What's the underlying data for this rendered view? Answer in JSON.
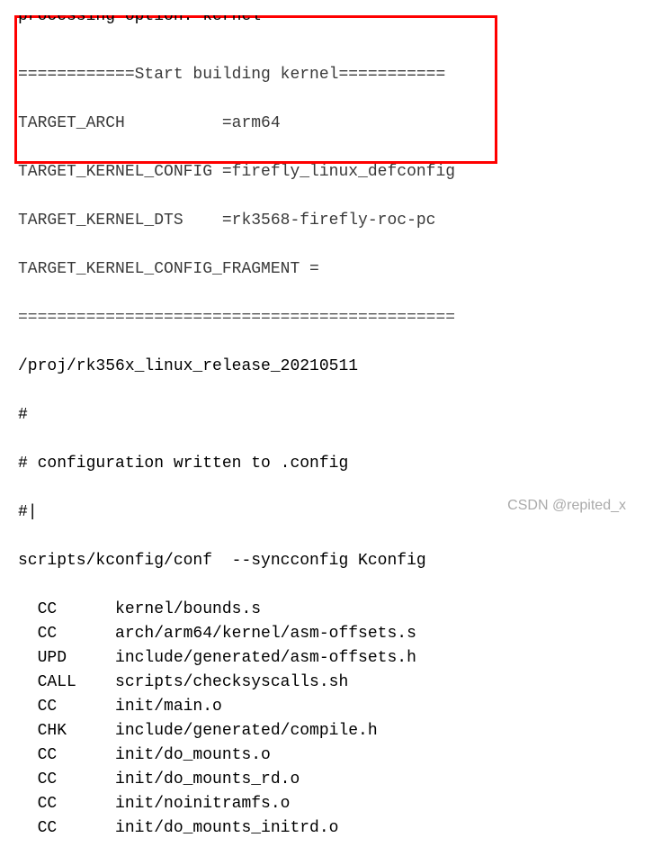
{
  "terminal": {
    "line_cutoff": "processing option: kernel",
    "boxed": {
      "l1": "============Start building kernel===========",
      "l2": "TARGET_ARCH          =arm64",
      "l3": "TARGET_KERNEL_CONFIG =firefly_linux_defconfig",
      "l4": "TARGET_KERNEL_DTS    =rk3568-firefly-roc-pc",
      "l5": "TARGET_KERNEL_CONFIG_FRAGMENT =",
      "l6": "============================================="
    },
    "path": "/proj/rk356x_linux_release_20210511",
    "hash1": "#",
    "config_written": "# configuration written to .config",
    "hash2": "#|",
    "scripts": "scripts/kconfig/conf  --syncconfig Kconfig",
    "build_lines": [
      {
        "cmd": "CC",
        "file": "kernel/bounds.s"
      },
      {
        "cmd": "CC",
        "file": "arch/arm64/kernel/asm-offsets.s"
      },
      {
        "cmd": "UPD",
        "file": "include/generated/asm-offsets.h"
      },
      {
        "cmd": "CALL",
        "file": "scripts/checksyscalls.sh"
      },
      {
        "cmd": "CC",
        "file": "init/main.o"
      },
      {
        "cmd": "CHK",
        "file": "include/generated/compile.h"
      },
      {
        "cmd": "CC",
        "file": "init/do_mounts.o"
      },
      {
        "cmd": "CC",
        "file": "init/do_mounts_rd.o"
      },
      {
        "cmd": "CC",
        "file": "init/noinitramfs.o"
      },
      {
        "cmd": "CC",
        "file": "init/do_mounts_initrd.o"
      }
    ]
  },
  "watermark": "CSDN @repited_x"
}
